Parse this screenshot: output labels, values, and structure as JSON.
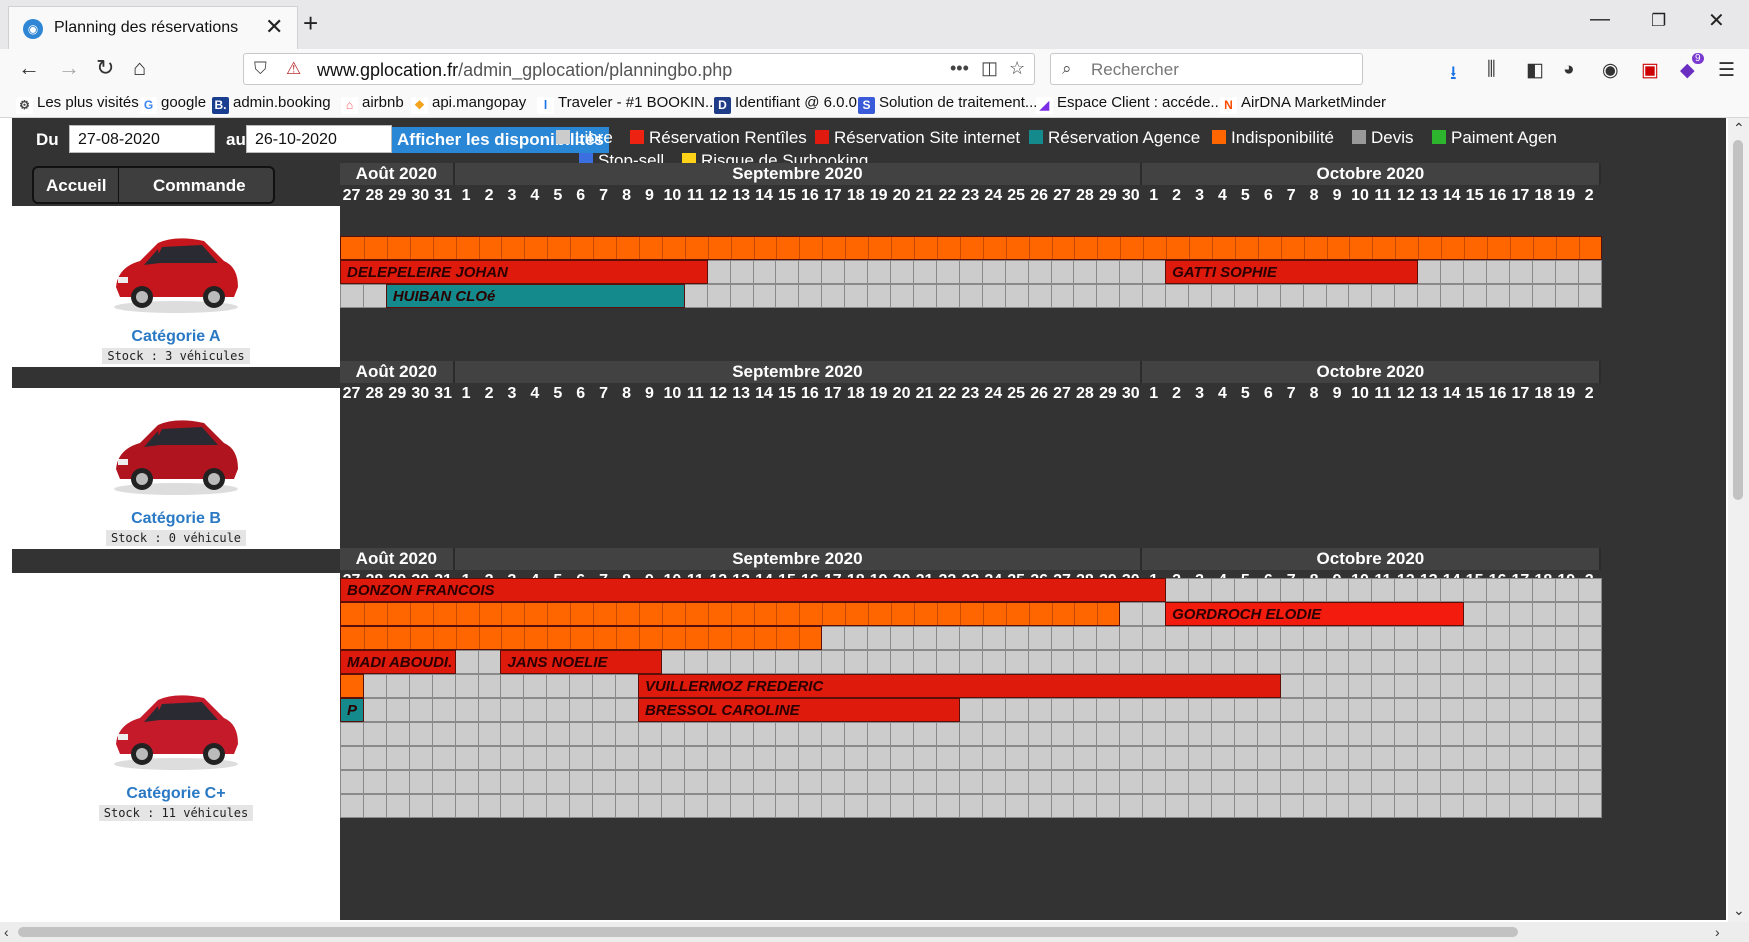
{
  "browser": {
    "tab_title": "Planning des réservations",
    "url_domain": "www.gplocation.fr",
    "url_path": "/admin_gplocation/planningbo.php",
    "search_placeholder": "Rechercher",
    "notification_count": "9",
    "bookmarks": [
      {
        "icon": "gear-icon",
        "label": "Les plus visités"
      },
      {
        "icon": "google-icon",
        "label": "google"
      },
      {
        "icon": "booking-icon",
        "label": "admin.booking"
      },
      {
        "icon": "airbnb-icon",
        "label": "airbnb"
      },
      {
        "icon": "mangopay-icon",
        "label": "api.mangopay"
      },
      {
        "icon": "traveler-icon",
        "label": "Traveler - #1 BOOKIN..."
      },
      {
        "icon": "d-icon",
        "label": "Identifiant @ 6.0.0"
      },
      {
        "icon": "s-icon",
        "label": "Solution de traitement..."
      },
      {
        "icon": "espace-icon",
        "label": "Espace Client : accéde..."
      },
      {
        "icon": "airdna-icon",
        "label": "AirDNA MarketMinder"
      }
    ]
  },
  "controls": {
    "from_label": "Du",
    "from_value": "27-08-2020",
    "to_label": "au",
    "to_value": "26-10-2020",
    "show_button": "Afficher les disponibilités",
    "nav_home": "Accueil",
    "nav_order": "Commande"
  },
  "legend": [
    {
      "label": "Libre",
      "color": "#cccccc"
    },
    {
      "label": "Réservation Rentîles",
      "color": "#ee2211"
    },
    {
      "label": "Réservation Site internet",
      "color": "#e01a0e"
    },
    {
      "label": "Réservation Agence",
      "color": "#148a8c"
    },
    {
      "label": "Indisponibilité",
      "color": "#ff6600"
    },
    {
      "label": "Devis",
      "color": "#999999"
    },
    {
      "label": "Paiment Agen",
      "color": "#2db52d"
    },
    {
      "label": "Stop-sell",
      "color": "#3b6fe0"
    },
    {
      "label": "Risque de Surbooking",
      "color": "#ffd21a"
    }
  ],
  "months": [
    {
      "label": "Août 2020",
      "days": [
        "27",
        "28",
        "29",
        "30",
        "31"
      ]
    },
    {
      "label": "Septembre 2020",
      "days": [
        "1",
        "2",
        "3",
        "4",
        "5",
        "6",
        "7",
        "8",
        "9",
        "10",
        "11",
        "12",
        "13",
        "14",
        "15",
        "16",
        "17",
        "18",
        "19",
        "20",
        "21",
        "22",
        "23",
        "24",
        "25",
        "26",
        "27",
        "28",
        "29",
        "30"
      ]
    },
    {
      "label": "Octobre 2020",
      "days": [
        "1",
        "2",
        "3",
        "4",
        "5",
        "6",
        "7",
        "8",
        "9",
        "10",
        "11",
        "12",
        "13",
        "14",
        "15",
        "16",
        "17",
        "18",
        "19",
        "2"
      ]
    }
  ],
  "categories": [
    {
      "name": "Catégorie A",
      "stock": "Stock : 3 véhicules",
      "car_color": "#c4161c",
      "rows": [
        {
          "cells": 55,
          "bars": [
            {
              "start": 0,
              "len": 55,
              "type": "indispo",
              "label": ""
            }
          ]
        },
        {
          "cells": 55,
          "bars": [
            {
              "start": 0,
              "len": 16,
              "type": "site",
              "label": "DELEPELEIRE JOHAN"
            },
            {
              "start": 36,
              "len": 11,
              "type": "site",
              "label": "GATTI SOPHIE"
            }
          ]
        },
        {
          "cells": 55,
          "bars": [
            {
              "start": 2,
              "len": 13,
              "type": "agence",
              "label": "HUIBAN CLOé"
            }
          ]
        }
      ]
    },
    {
      "name": "Catégorie B",
      "stock": "Stock : 0 véhicule",
      "car_color": "#b0151f",
      "rows": []
    },
    {
      "name": "Catégorie C+",
      "stock": "Stock : 11 véhicules",
      "car_color": "#c41a2a",
      "rows": [
        {
          "cells": 55,
          "bars": [
            {
              "start": 0,
              "len": 36,
              "type": "site",
              "label": "BONZON FRANCOIS"
            }
          ]
        },
        {
          "cells": 55,
          "bars": [
            {
              "start": 0,
              "len": 34,
              "type": "indispo",
              "label": ""
            },
            {
              "start": 36,
              "len": 13,
              "type": "rentiles",
              "label": "GORDROCH ELODIE"
            }
          ]
        },
        {
          "cells": 55,
          "bars": [
            {
              "start": 0,
              "len": 21,
              "type": "indispo",
              "label": ""
            }
          ]
        },
        {
          "cells": 55,
          "bars": [
            {
              "start": 0,
              "len": 5,
              "type": "site",
              "label": "MADI ABOUDI."
            },
            {
              "start": 7,
              "len": 7,
              "type": "site",
              "label": "JANS NOELIE"
            }
          ]
        },
        {
          "cells": 55,
          "bars": [
            {
              "start": 0,
              "len": 1,
              "type": "indispo",
              "label": ""
            },
            {
              "start": 13,
              "len": 28,
              "type": "site",
              "label": "VUILLERMOZ FREDERIC"
            }
          ]
        },
        {
          "cells": 55,
          "bars": [
            {
              "start": 0,
              "len": 1,
              "type": "agence",
              "label": "P"
            },
            {
              "start": 13,
              "len": 14,
              "type": "site",
              "label": "BRESSOL CAROLINE"
            }
          ]
        },
        {
          "cells": 55,
          "bars": []
        },
        {
          "cells": 55,
          "bars": []
        },
        {
          "cells": 55,
          "bars": []
        },
        {
          "cells": 55,
          "bars": []
        }
      ]
    }
  ],
  "bar_colors": {
    "indispo": "#ff6600",
    "site": "#dd1a0c",
    "rentiles": "#f21b0e",
    "agence": "#148a8c"
  }
}
